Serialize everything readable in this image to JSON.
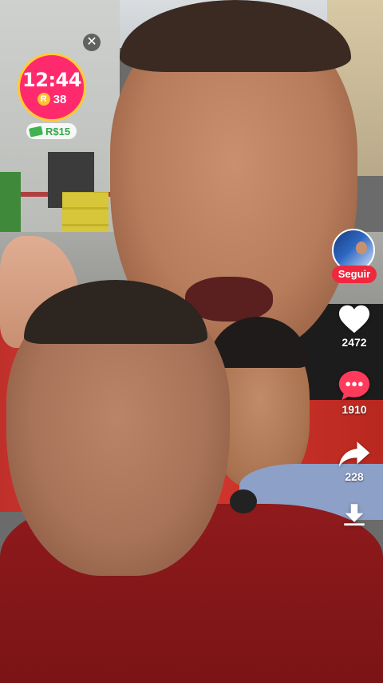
{
  "overlay": {
    "close_icon": "close-icon",
    "timer": {
      "time": "12:44",
      "coins": "38",
      "coin_icon_glyph": "R"
    },
    "money": {
      "label": "R$15",
      "icon": "cash-icon"
    }
  },
  "sidebar": {
    "follow_label": "Seguir",
    "likes": "2472",
    "comments": "1910",
    "shares": "228",
    "download_icon": "download-icon"
  },
  "colors": {
    "timer_bg": "#ff2a6d",
    "timer_ring": "#ffcc33",
    "follow_bg": "#f0283e",
    "money_text": "#36a84a"
  }
}
